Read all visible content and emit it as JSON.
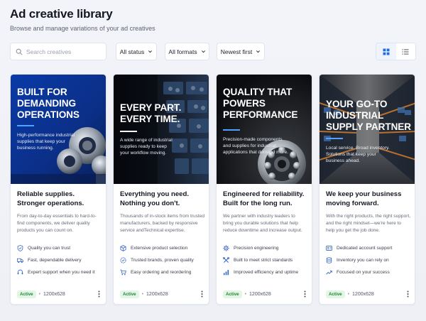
{
  "header": {
    "title": "Ad creative library",
    "subtitle": "Browse and manage variations of your ad creatives"
  },
  "toolbar": {
    "search_placeholder": "Search creatives",
    "status_filter": "All status",
    "format_filter": "All formats",
    "sort": "Newest first",
    "view_active": "grid"
  },
  "colors": {
    "accent_blue": "#1f6fde",
    "status_green": "#24843a",
    "icon_blue": "#3567c4"
  },
  "cards": [
    {
      "headline": "Built for\ndemanding\noperations",
      "creative_sub": "High-performance industrial\nsupplies that keep your\nbusiness running.",
      "title": "Reliable supplies.\nStronger operations.",
      "description": "From day-to-day essentials to hard-to-\nfind components, we deliver quality\nproducts you can count on.",
      "features": [
        {
          "icon": "shield-check-icon",
          "text": "Quality you can trust"
        },
        {
          "icon": "truck-icon",
          "text": "Fast, dependable delivery"
        },
        {
          "icon": "headset-icon",
          "text": "Expert support when you need it"
        }
      ],
      "status": "Active",
      "size": "1200x628"
    },
    {
      "headline": "Every part.\nEvery time.",
      "creative_sub": "A wide range of industrial\nsupplies ready to keep\nyour workflow moving.",
      "title": "Everything you need.\nNothing you don't.",
      "description": "Thousands of in-stock items from trusted\nmanufacturers, backed by responsive\nservice andTechnical expertise.",
      "features": [
        {
          "icon": "box-icon",
          "text": "Extensive product selection"
        },
        {
          "icon": "badge-check-icon",
          "text": "Trusted brands, proven quality"
        },
        {
          "icon": "cart-icon",
          "text": "Easy ordering and reordering"
        }
      ],
      "status": "Active",
      "size": "1200x628"
    },
    {
      "headline": "Quality that\npowers\nperformance",
      "creative_sub": "Precision-made components\nand supplies for industrial\napplications that demand more.",
      "title": "Engineered for reliability.\nBuilt for the long run.",
      "description": "We partner with industry leaders to\nbring you durable solutions that help\nreduce downtime and increase output.",
      "features": [
        {
          "icon": "gear-icon",
          "text": "Precision engineering"
        },
        {
          "icon": "tools-icon",
          "text": "Built to meet strict standards"
        },
        {
          "icon": "bar-chart-icon",
          "text": "Improved efficiency and uptime"
        }
      ],
      "status": "Active",
      "size": "1200x628"
    },
    {
      "headline": "Your go-to\nindustrial\nsupply partner",
      "creative_sub": "Local service. Broad inventory.\nSolutions that keep your\nbusiness ahead.",
      "title": "We keep your business\nmoving forward.",
      "description": "With the right products, the right support,\nand the right mindset—we're here to\nhelp you get the job done.",
      "features": [
        {
          "icon": "user-card-icon",
          "text": "Dedicated account support"
        },
        {
          "icon": "database-icon",
          "text": "Inventory you can rely on"
        },
        {
          "icon": "trend-up-icon",
          "text": "Focused on your success"
        }
      ],
      "status": "Active",
      "size": "1200x628"
    }
  ]
}
